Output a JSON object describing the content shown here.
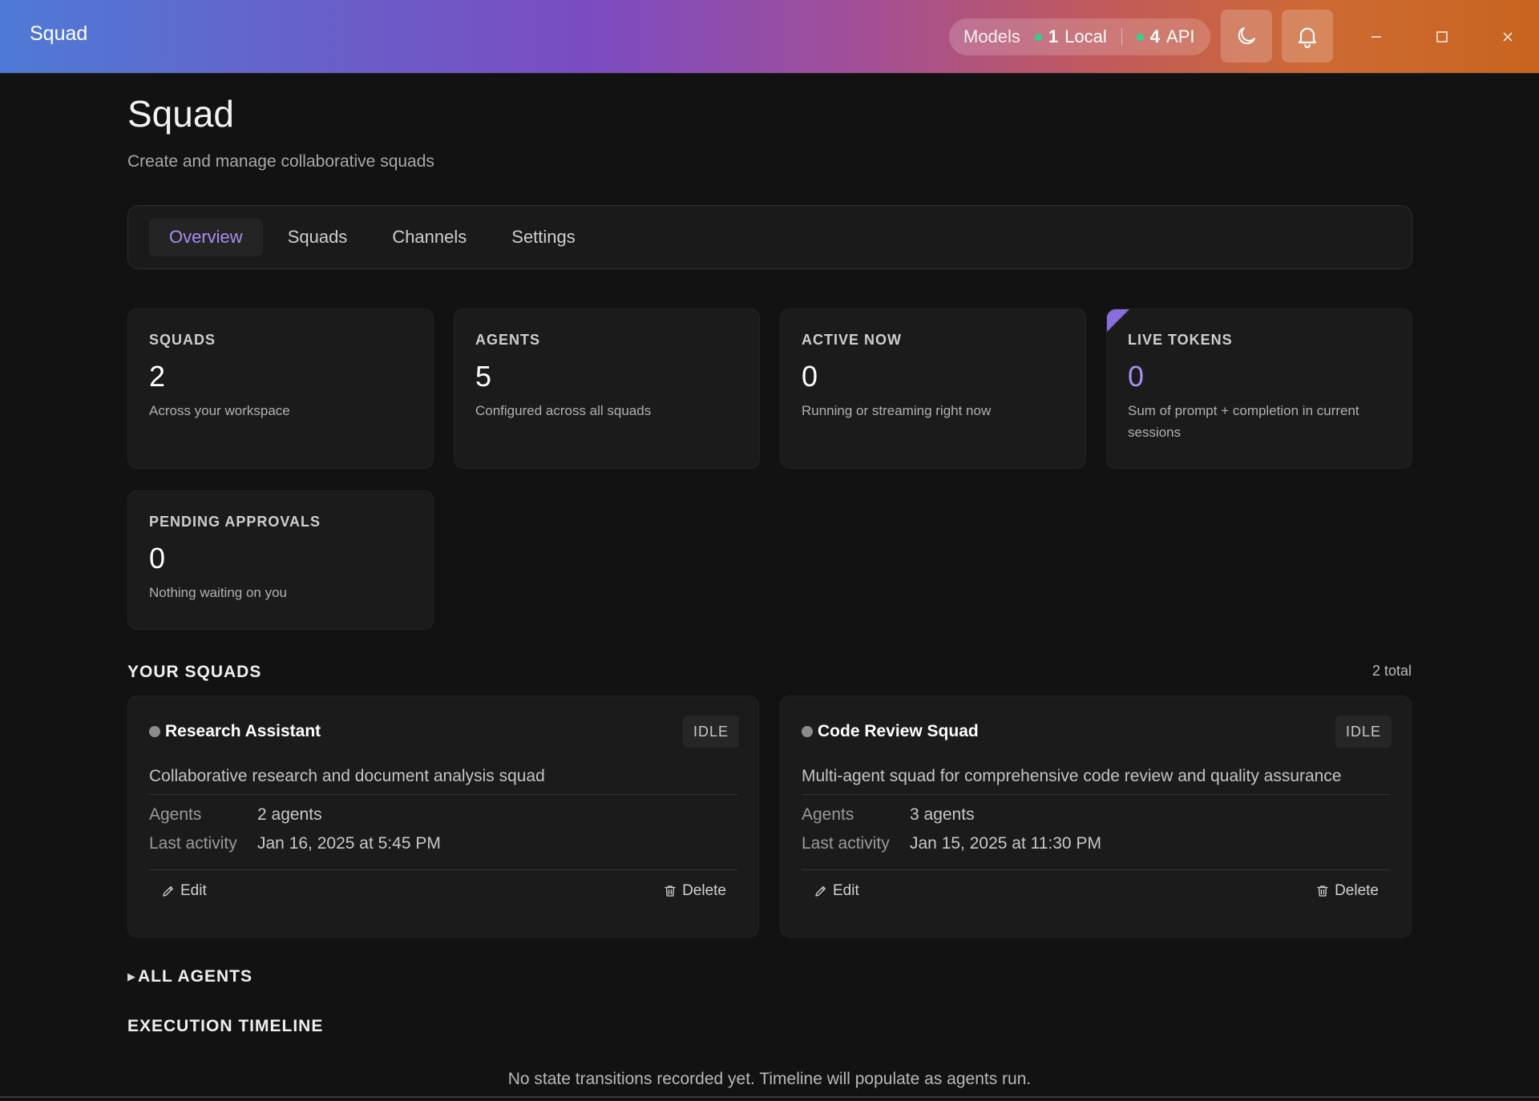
{
  "app": {
    "title": "Squad"
  },
  "titlebar": {
    "models_label": "Models",
    "local_count": "1",
    "local_label": "Local",
    "api_count": "4",
    "api_label": "API",
    "status_color": "#2fd18f",
    "theme_icon": "moon-icon",
    "notify_icon": "bell-icon"
  },
  "page": {
    "title": "Squad",
    "subtitle": "Create and manage collaborative squads"
  },
  "tabs": [
    {
      "label": "Overview",
      "active": true
    },
    {
      "label": "Squads",
      "active": false
    },
    {
      "label": "Channels",
      "active": false
    },
    {
      "label": "Settings",
      "active": false
    }
  ],
  "stats": {
    "squads": {
      "label": "SQUADS",
      "value": "2",
      "desc": "Across your workspace"
    },
    "agents": {
      "label": "AGENTS",
      "value": "5",
      "desc": "Configured across all squads"
    },
    "active_now": {
      "label": "ACTIVE NOW",
      "value": "0",
      "desc": "Running or streaming right now"
    },
    "live_tokens": {
      "label": "LIVE TOKENS",
      "value": "0",
      "desc": "Sum of prompt + completion in current sessions",
      "accent": "#a98df2"
    },
    "pending": {
      "label": "PENDING APPROVALS",
      "value": "0",
      "desc": "Nothing waiting on you"
    }
  },
  "your_squads": {
    "title": "YOUR SQUADS",
    "total": "2 total",
    "items": [
      {
        "name": "Research Assistant",
        "status": "IDLE",
        "description": "Collaborative research and document analysis squad",
        "agents_label": "Agents",
        "agents_value": "2 agents",
        "activity_label": "Last activity",
        "activity_value": "Jan 16, 2025 at 5:45 PM",
        "edit_label": "Edit",
        "delete_label": "Delete"
      },
      {
        "name": "Code Review Squad",
        "status": "IDLE",
        "description": "Multi-agent squad for comprehensive code review and quality assurance",
        "agents_label": "Agents",
        "agents_value": "3 agents",
        "activity_label": "Last activity",
        "activity_value": "Jan 15, 2025 at 11:30 PM",
        "edit_label": "Edit",
        "delete_label": "Delete"
      }
    ]
  },
  "all_agents": {
    "title": "ALL AGENTS",
    "expanded": false
  },
  "timeline": {
    "title": "EXECUTION TIMELINE",
    "empty_message": "No state transitions recorded yet. Timeline will populate as agents run."
  }
}
